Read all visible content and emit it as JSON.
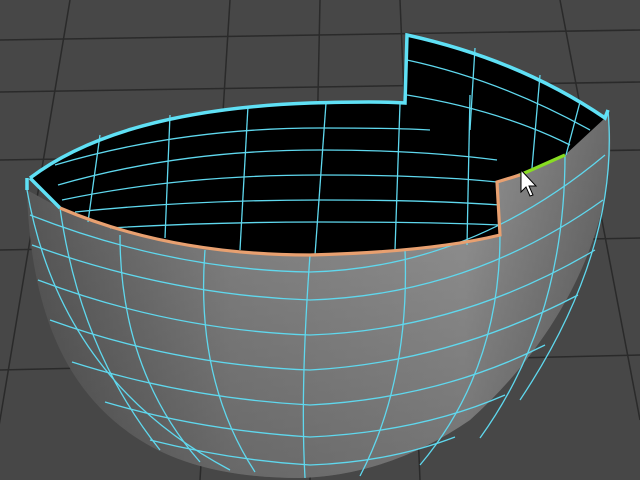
{
  "viewport": {
    "name": "3d-viewport",
    "background_color": "#474747",
    "grid_color": "#2a2a2a",
    "grid_axis_color": "#1a1a1a"
  },
  "mesh": {
    "object": "half-sphere-bowl",
    "shell_color": "#8f8f8f",
    "interior_color": "#000000",
    "wireframe_color": "#5fd8ee",
    "border_edge_color": "#5fe0f5",
    "selected_loop_color": "#e8a070",
    "highlighted_edge_color": "#88dd22"
  },
  "cursor": {
    "icon": "arrow-cursor-icon",
    "color": "#ffffff"
  }
}
